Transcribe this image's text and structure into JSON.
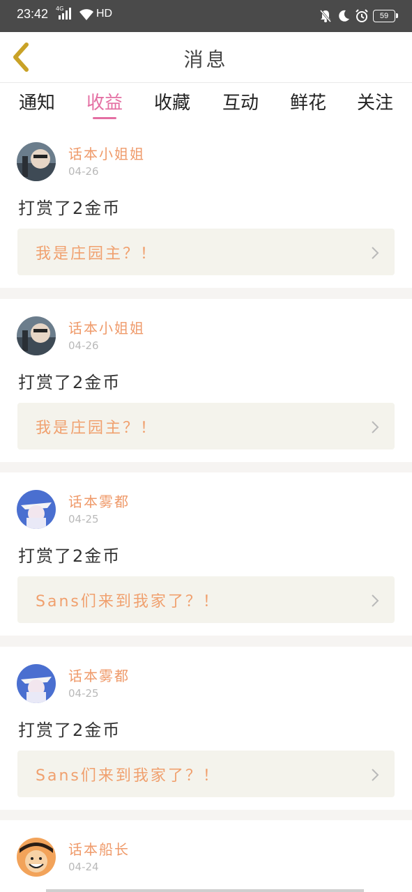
{
  "status_bar": {
    "time": "23:42",
    "network": "4G",
    "hd": "HD",
    "battery": "59"
  },
  "header": {
    "title": "消息",
    "back_icon": "chevron-left-icon"
  },
  "tabs": [
    {
      "label": "通知",
      "active": false
    },
    {
      "label": "收益",
      "active": true
    },
    {
      "label": "收藏",
      "active": false
    },
    {
      "label": "互动",
      "active": false
    },
    {
      "label": "鲜花",
      "active": false
    },
    {
      "label": "关注",
      "active": false
    }
  ],
  "items": [
    {
      "user": "话本小姐姐",
      "date": "04-26",
      "action": "打赏了2金币",
      "book": "我是庄园主？！",
      "avatar": "man-sunglasses"
    },
    {
      "user": "话本小姐姐",
      "date": "04-26",
      "action": "打赏了2金币",
      "book": "我是庄园主？！",
      "avatar": "man-sunglasses"
    },
    {
      "user": "话本雾都",
      "date": "04-25",
      "action": "打赏了2金币",
      "book": "Sans们来到我家了？！",
      "avatar": "anime-white-hat"
    },
    {
      "user": "话本雾都",
      "date": "04-25",
      "action": "打赏了2金币",
      "book": "Sans们来到我家了？！",
      "avatar": "anime-white-hat"
    },
    {
      "user": "话本船长",
      "date": "04-24",
      "action": "",
      "book": "",
      "avatar": "anime-straw-hat"
    }
  ],
  "colors": {
    "accent_pink": "#e46fa3",
    "name_orange": "#ef9a6a",
    "book_bg": "#f4f3ec",
    "back_icon": "#c9a227"
  }
}
